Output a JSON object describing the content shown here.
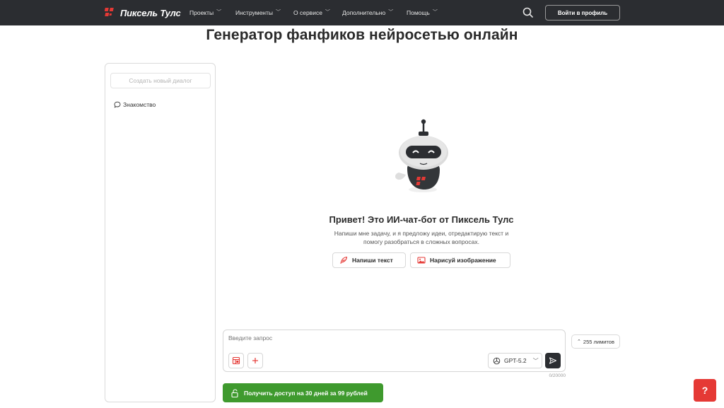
{
  "header": {
    "logo_text": "Пиксель Тулс",
    "nav": [
      {
        "label": "Проекты"
      },
      {
        "label": "Инструменты"
      },
      {
        "label": "О сервисе"
      },
      {
        "label": "Дополнительно"
      },
      {
        "label": "Помощь"
      }
    ],
    "search_icon": "search-icon",
    "login_label": "Войти в профиль",
    "background": "#2b2d31"
  },
  "page": {
    "title": "Генератор фанфиков нейросетью онлайн"
  },
  "sidebar": {
    "new_dialog_label": "Создать новый диалог",
    "dialogs": [
      {
        "label": "Знакомство",
        "icon": "chat-bubble-icon"
      }
    ]
  },
  "welcome": {
    "title": "Привет! Это ИИ-чат-бот от Пиксель Тулс",
    "subtitle_line1": "Напиши мне задачу, и я предложу идеи, отредактирую текст и",
    "subtitle_line2": "помогу разобраться в сложных вопросах.",
    "actions": [
      {
        "label": "Напиши текст",
        "icon": "feather-icon"
      },
      {
        "label": "Нарисуй изображение",
        "icon": "image-icon"
      }
    ]
  },
  "composer": {
    "placeholder": "Введите запрос",
    "value": "",
    "model": "GPT-5.2",
    "counter": "0/20000"
  },
  "limits": {
    "label": "255 лимитов"
  },
  "access_button": {
    "label": "Получить доступ на 30 дней за 99 рублей"
  },
  "help": {
    "label": "?"
  },
  "colors": {
    "accent_red": "#e53935",
    "accent_green": "#3f9a2e",
    "dark": "#2b2d31"
  }
}
